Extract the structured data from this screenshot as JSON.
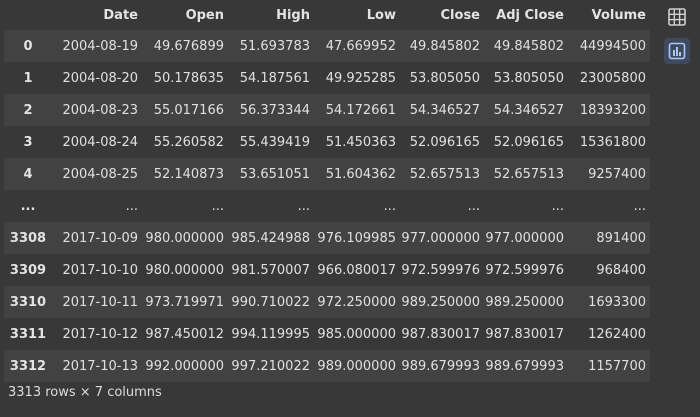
{
  "table": {
    "columns": [
      "",
      "Date",
      "Open",
      "High",
      "Low",
      "Close",
      "Adj Close",
      "Volume"
    ],
    "rows": [
      {
        "index": "0",
        "cells": [
          "2004-08-19",
          "49.676899",
          "51.693783",
          "47.669952",
          "49.845802",
          "49.845802",
          "44994500"
        ]
      },
      {
        "index": "1",
        "cells": [
          "2004-08-20",
          "50.178635",
          "54.187561",
          "49.925285",
          "53.805050",
          "53.805050",
          "23005800"
        ]
      },
      {
        "index": "2",
        "cells": [
          "2004-08-23",
          "55.017166",
          "56.373344",
          "54.172661",
          "54.346527",
          "54.346527",
          "18393200"
        ]
      },
      {
        "index": "3",
        "cells": [
          "2004-08-24",
          "55.260582",
          "55.439419",
          "51.450363",
          "52.096165",
          "52.096165",
          "15361800"
        ]
      },
      {
        "index": "4",
        "cells": [
          "2004-08-25",
          "52.140873",
          "53.651051",
          "51.604362",
          "52.657513",
          "52.657513",
          "9257400"
        ]
      },
      {
        "index": "...",
        "cells": [
          "...",
          "...",
          "...",
          "...",
          "...",
          "...",
          "..."
        ]
      },
      {
        "index": "3308",
        "cells": [
          "2017-10-09",
          "980.000000",
          "985.424988",
          "976.109985",
          "977.000000",
          "977.000000",
          "891400"
        ]
      },
      {
        "index": "3309",
        "cells": [
          "2017-10-10",
          "980.000000",
          "981.570007",
          "966.080017",
          "972.599976",
          "972.599976",
          "968400"
        ]
      },
      {
        "index": "3310",
        "cells": [
          "2017-10-11",
          "973.719971",
          "990.710022",
          "972.250000",
          "989.250000",
          "989.250000",
          "1693300"
        ]
      },
      {
        "index": "3311",
        "cells": [
          "2017-10-12",
          "987.450012",
          "994.119995",
          "985.000000",
          "987.830017",
          "987.830017",
          "1262400"
        ]
      },
      {
        "index": "3312",
        "cells": [
          "2017-10-13",
          "992.000000",
          "997.210022",
          "989.000000",
          "989.679993",
          "989.679993",
          "1157700"
        ]
      }
    ]
  },
  "summary": "3313 rows × 7 columns",
  "toolbar": {
    "buttons": [
      {
        "name": "table-view",
        "icon": "table-icon"
      },
      {
        "name": "chart-suggest",
        "icon": "bar-chart-icon"
      }
    ]
  },
  "colors": {
    "background": "#383838",
    "row_odd": "#424242",
    "text": "#e3e3e3",
    "chart_button_bg": "#3f4a5e",
    "chart_button_icon": "#a8c7fa"
  }
}
